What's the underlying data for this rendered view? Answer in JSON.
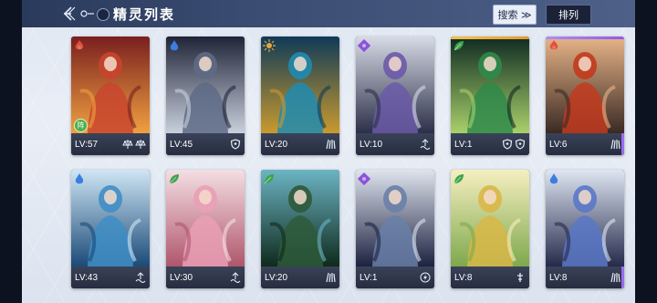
{
  "header": {
    "title": "精灵列表",
    "search_label": "搜索 ≫",
    "sort_label": "排列"
  },
  "cards": [
    {
      "level": "LV:57",
      "element": "fire",
      "element_color": "#e0503a",
      "badge": "阵",
      "icons": [
        "scale-icon",
        "scale-icon"
      ],
      "palette": [
        "#7a1f1f",
        "#c8452e",
        "#f0a040"
      ]
    },
    {
      "level": "LV:45",
      "element": "water",
      "element_color": "#3c7ee0",
      "icons": [
        "shield-icon"
      ],
      "palette": [
        "#1f2438",
        "#5e6a86",
        "#c9d0dc"
      ]
    },
    {
      "level": "LV:20",
      "element": "light",
      "element_color": "#e6a53a",
      "icons": [
        "claw-icon"
      ],
      "palette": [
        "#0f3a58",
        "#1f8bb0",
        "#c99a2e"
      ]
    },
    {
      "level": "LV:10",
      "element": "dark",
      "element_color": "#8a54d8",
      "icons": [
        "wave-icon"
      ],
      "palette": [
        "#d7dbe6",
        "#6b5aa8",
        "#2b2f48"
      ]
    },
    {
      "level": "LV:1",
      "element": "grass",
      "element_color": "#3aa44a",
      "icons": [
        "shield-icon",
        "shield-icon"
      ],
      "palette": [
        "#0e2a22",
        "#2f8a4a",
        "#a9d06a"
      ]
    },
    {
      "level": "LV:6",
      "element": "fire",
      "element_color": "#e0503a",
      "icons": [
        "claw-icon"
      ],
      "palette": [
        "#e8b488",
        "#c23b1e",
        "#3a2a24"
      ]
    },
    {
      "level": "LV:43",
      "element": "water",
      "element_color": "#3c7ee0",
      "icons": [
        "wave-icon"
      ],
      "palette": [
        "#cfe6f4",
        "#3f8ec6",
        "#1b4a78"
      ]
    },
    {
      "level": "LV:30",
      "element": "grass",
      "element_color": "#3aa44a",
      "icons": [
        "wave-icon"
      ],
      "palette": [
        "#f4dfe4",
        "#e9a0b6",
        "#b0566c"
      ]
    },
    {
      "level": "LV:20",
      "element": "grass",
      "element_color": "#3aa44a",
      "icons": [
        "claw-icon"
      ],
      "palette": [
        "#6cb4c4",
        "#2e5a3a",
        "#0f2a1c"
      ]
    },
    {
      "level": "LV:1",
      "element": "dark",
      "element_color": "#8a54d8",
      "icons": [
        "bolt-icon"
      ],
      "palette": [
        "#dfe4ee",
        "#6a7fa8",
        "#1c2240"
      ]
    },
    {
      "level": "LV:8",
      "element": "grass",
      "element_color": "#3aa44a",
      "icons": [
        "sword-icon"
      ],
      "palette": [
        "#f6efc0",
        "#d9b748",
        "#7ea84c"
      ]
    },
    {
      "level": "LV:8",
      "element": "water",
      "element_color": "#3c7ee0",
      "icons": [
        "claw-icon"
      ],
      "palette": [
        "#dfe6f2",
        "#5b78c8",
        "#242a4a"
      ]
    }
  ]
}
